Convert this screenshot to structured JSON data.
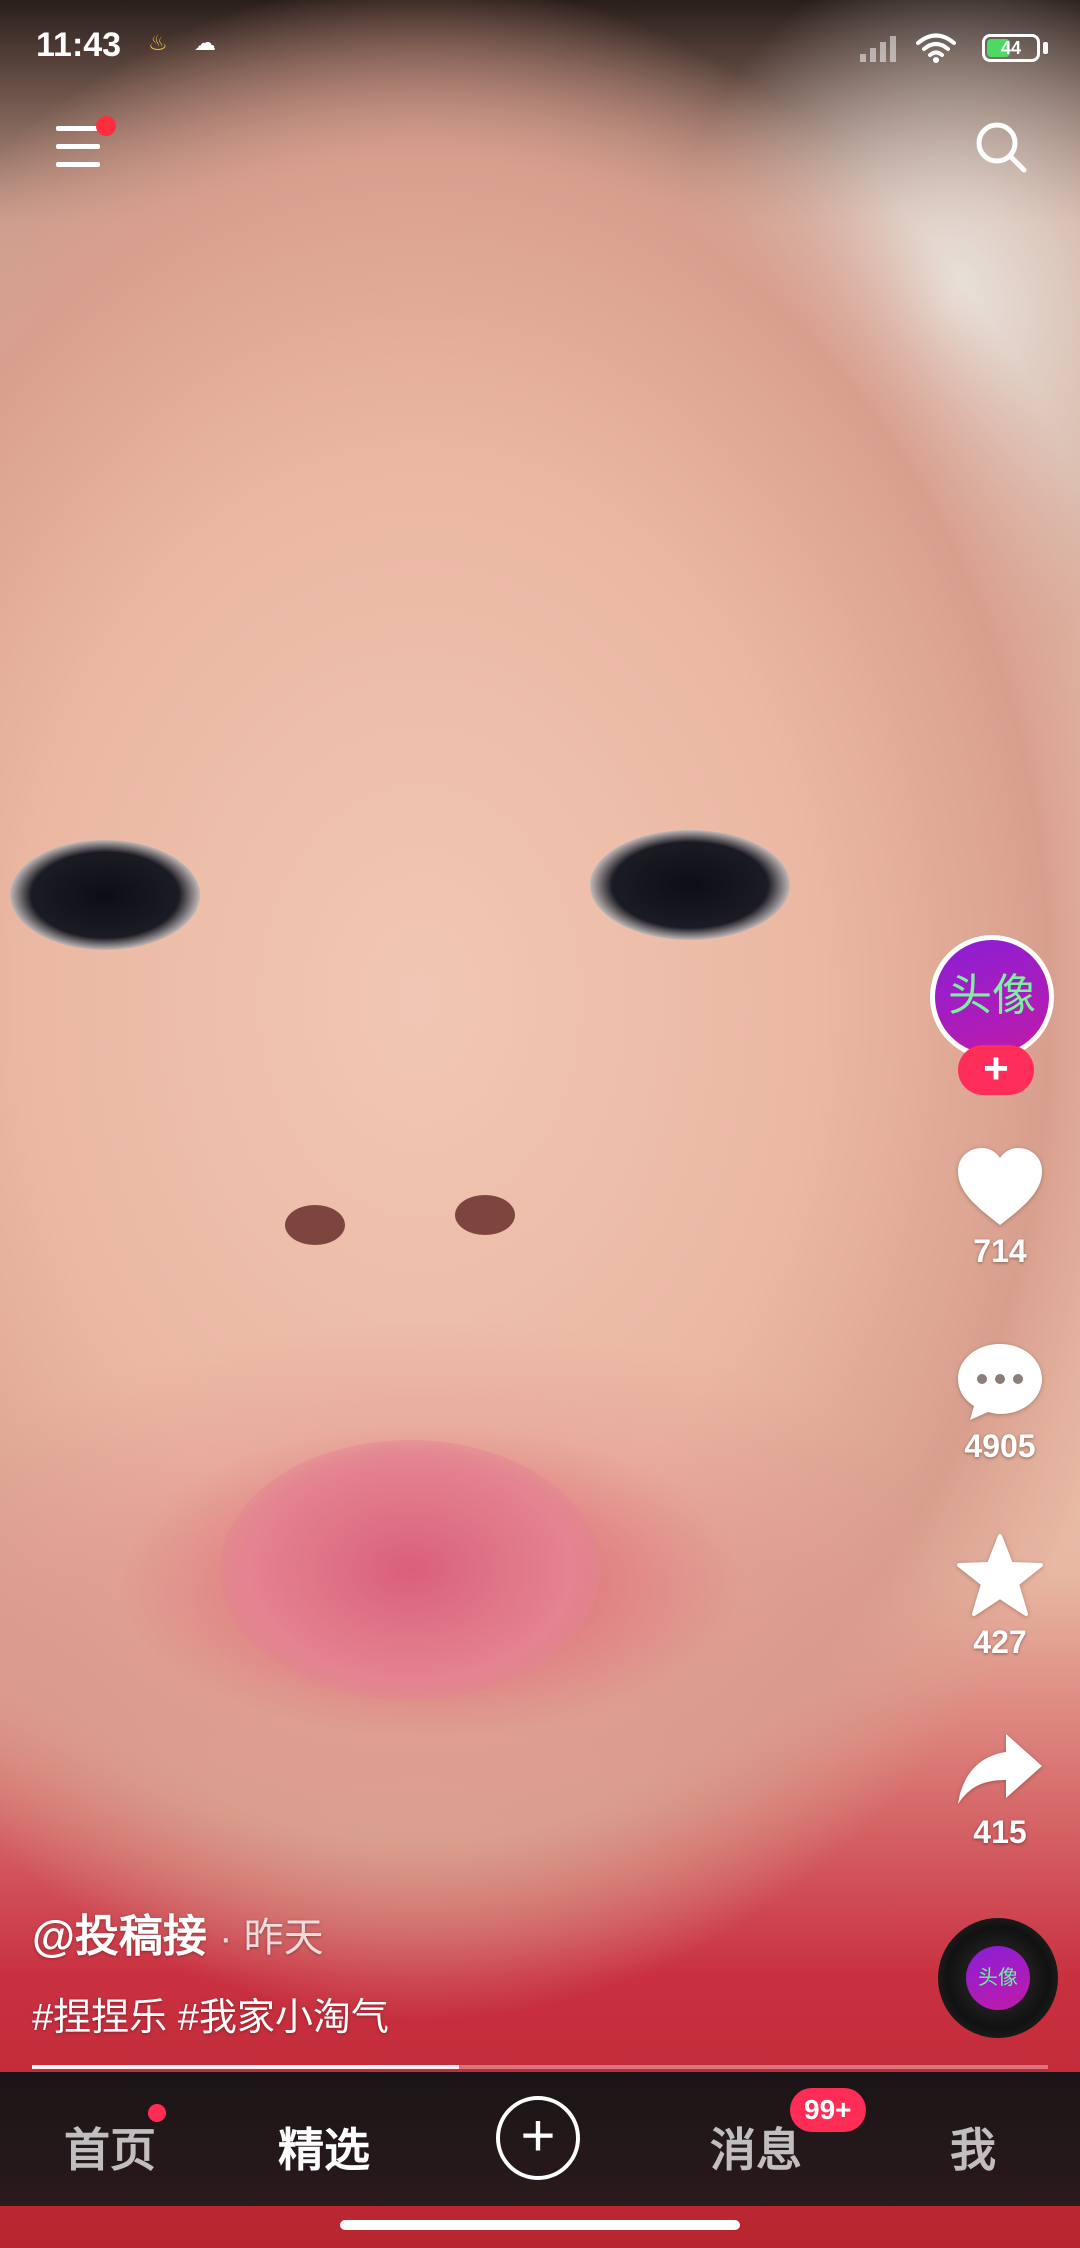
{
  "status": {
    "time": "11:43",
    "battery": "44"
  },
  "header": {
    "menu_icon": "menu-icon",
    "search_icon": "search-icon"
  },
  "side_actions": {
    "avatar_label": "头像",
    "follow_label": "+",
    "like_count": "714",
    "comment_count": "4905",
    "favorite_count": "427",
    "share_count": "415",
    "music_disc_label": "头像"
  },
  "post": {
    "author": "@投稿接",
    "time": "· 昨天",
    "tags": "#捏捏乐 #我家小淘气",
    "progress": 0.42
  },
  "tabbar": {
    "home": "首页",
    "featured": "精选",
    "create": "+",
    "messages": "消息",
    "messages_badge": "99+",
    "me": "我"
  },
  "colors": {
    "accent": "#ff2d55",
    "battery_green": "#4cd964"
  }
}
